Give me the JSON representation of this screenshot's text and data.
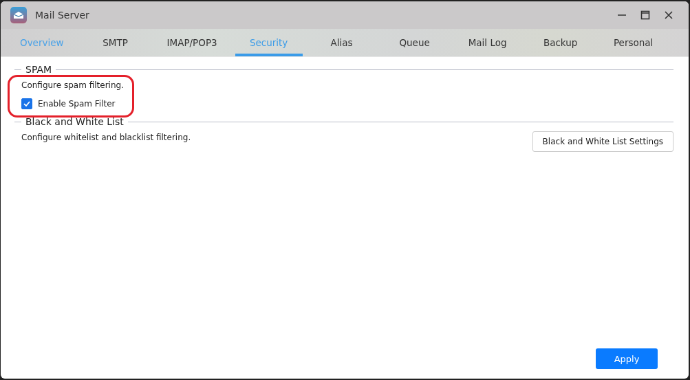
{
  "window": {
    "title": "Mail Server"
  },
  "tabs": [
    {
      "label": "Overview",
      "selected": false
    },
    {
      "label": "SMTP",
      "selected": false
    },
    {
      "label": "IMAP/POP3",
      "selected": false
    },
    {
      "label": "Security",
      "selected": true
    },
    {
      "label": "Alias",
      "selected": false
    },
    {
      "label": "Queue",
      "selected": false
    },
    {
      "label": "Mail Log",
      "selected": false
    },
    {
      "label": "Backup",
      "selected": false
    },
    {
      "label": "Personal",
      "selected": false
    }
  ],
  "sections": [
    {
      "title": "SPAM",
      "description": "Configure spam filtering.",
      "checkbox": {
        "label": "Enable Spam Filter",
        "checked": true
      }
    },
    {
      "title": "Black and White List",
      "description": "Configure whitelist and blacklist filtering.",
      "button": "Black and White List Settings"
    }
  ],
  "apply_button": "Apply"
}
